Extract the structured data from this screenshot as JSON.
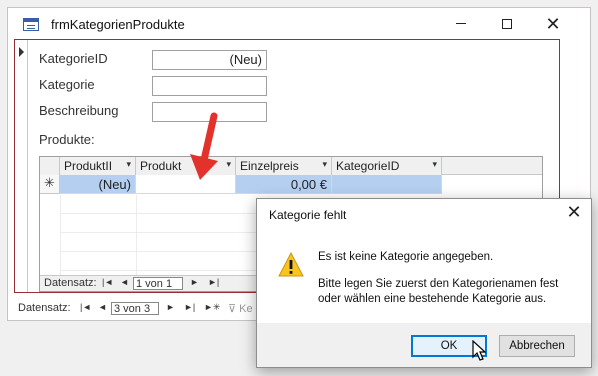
{
  "window": {
    "title": "frmKategorienProdukte",
    "close_glyph": "✕"
  },
  "form": {
    "kategorie_id": {
      "label": "KategorieID",
      "value": "(Neu)"
    },
    "kategorie": {
      "label": "Kategorie",
      "value": ""
    },
    "beschreibung": {
      "label": "Beschreibung",
      "value": ""
    },
    "produkte_label": "Produkte:"
  },
  "subform": {
    "columns": [
      {
        "label": "ProduktII"
      },
      {
        "label": "Produkt"
      },
      {
        "label": "Einzelpreis"
      },
      {
        "label": "KategorieID"
      }
    ],
    "new_row": {
      "selector": "✳",
      "produkt_id": "(Neu)",
      "produkt": "",
      "einzelpreis": "0,00 €",
      "kategorie_id": ""
    },
    "nav": {
      "label": "Datensatz:",
      "first": "|◄",
      "prev": "◄",
      "record": "1 von 1",
      "next": "►",
      "last": "►|"
    }
  },
  "main_nav": {
    "label": "Datensatz:",
    "first": "|◄",
    "prev": "◄",
    "record": "3 von 3",
    "next": "►",
    "last": "►|",
    "new": "►✳",
    "filter_partial": "Ke"
  },
  "dialog": {
    "title": "Kategorie fehlt",
    "close_glyph": "✕",
    "message_line1": "Es ist keine Kategorie angegeben.",
    "message_line2": "Bitte legen Sie zuerst den Kategorienamen fest oder wählen eine bestehende Kategorie aus.",
    "ok_label": "OK",
    "cancel_label": "Abbrechen"
  },
  "colors": {
    "selection_blue": "#b4cff0",
    "form_border": "#9b2c38",
    "arrow_red": "#e3322b",
    "focus_blue": "#0078d7"
  }
}
